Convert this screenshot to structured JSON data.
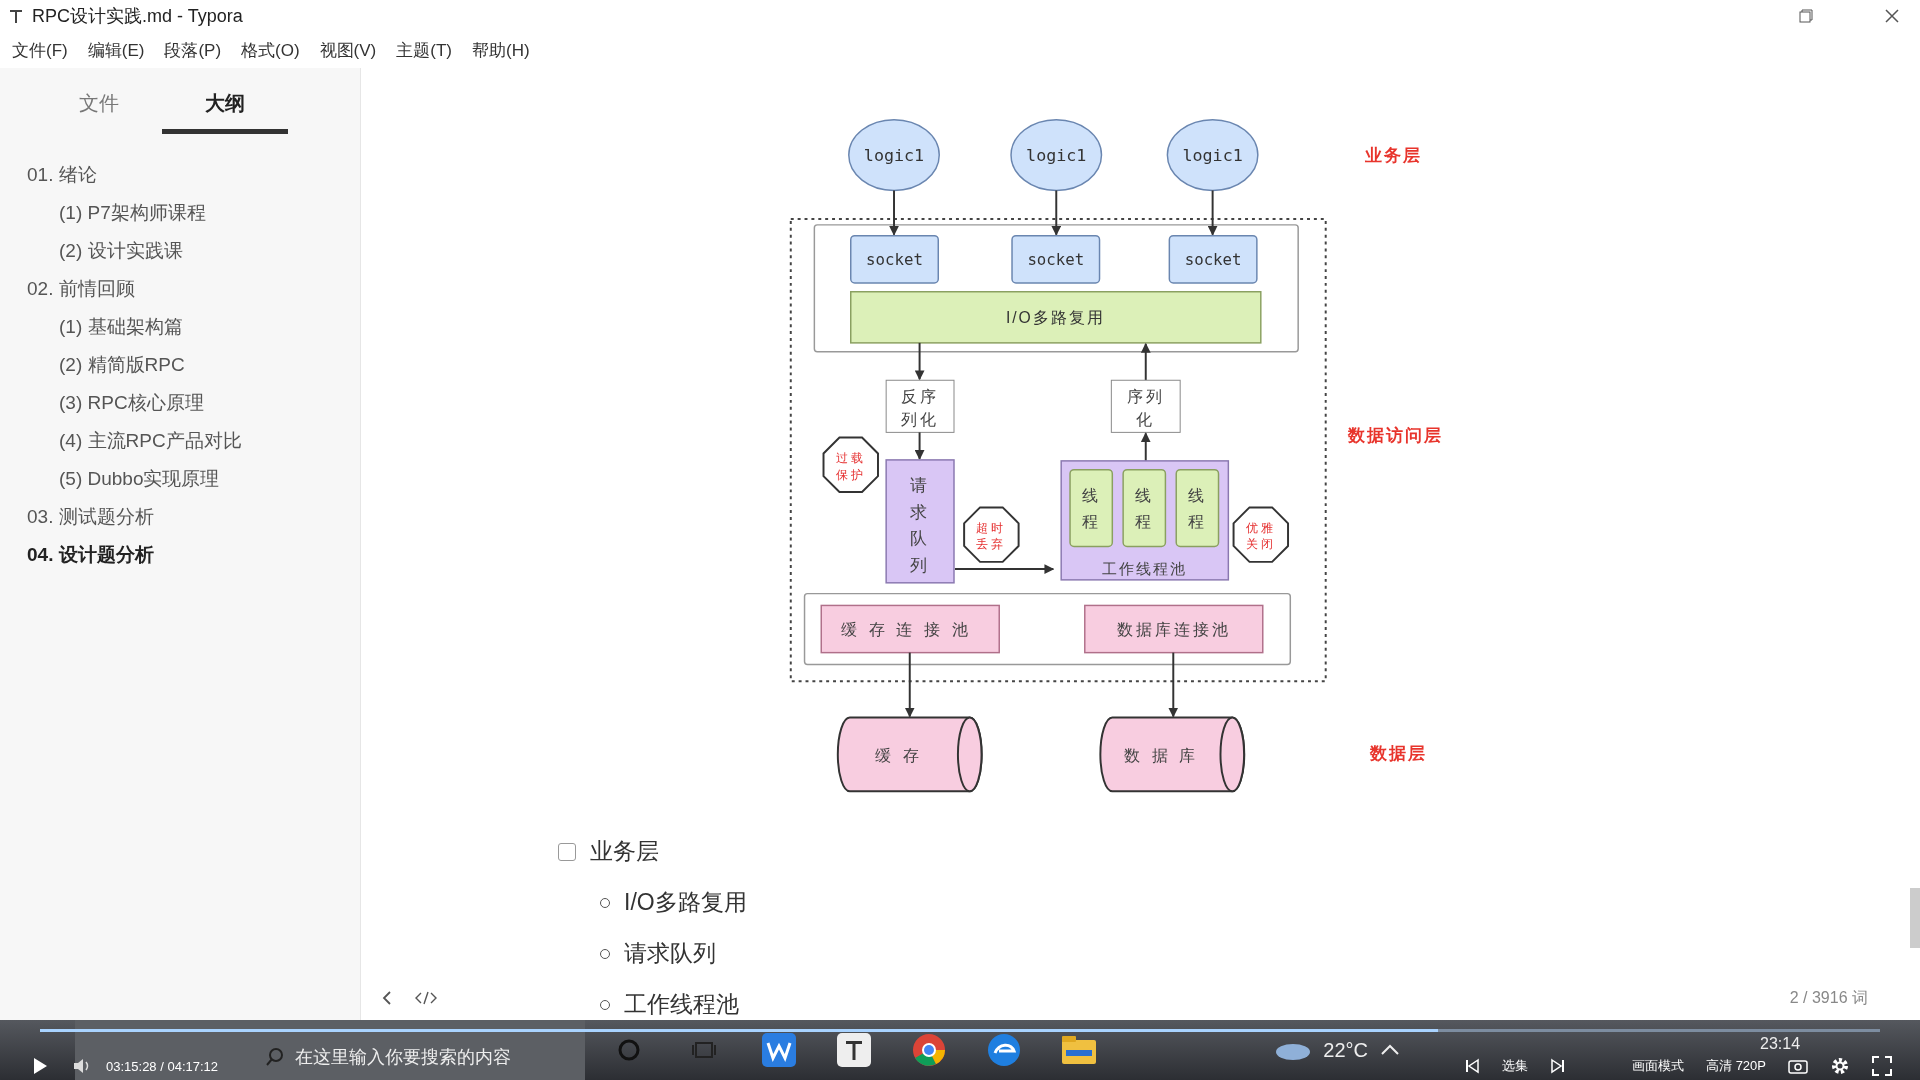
{
  "window": {
    "title": "RPC设计实践.md - Typora"
  },
  "menu": [
    "文件(F)",
    "编辑(E)",
    "段落(P)",
    "格式(O)",
    "视图(V)",
    "主题(T)",
    "帮助(H)"
  ],
  "sidebar": {
    "tabs": [
      {
        "label": "文件",
        "selected": false
      },
      {
        "label": "大纲",
        "selected": true
      }
    ],
    "outline": [
      {
        "label": "01. 绪论",
        "selected": false,
        "children": [
          {
            "label": "(1)  P7架构师课程",
            "selected": false
          },
          {
            "label": "(2)  设计实践课",
            "selected": false
          }
        ]
      },
      {
        "label": "02. 前情回顾",
        "selected": false,
        "children": [
          {
            "label": "(1)  基础架构篇",
            "selected": false
          },
          {
            "label": "(2)  精简版RPC",
            "selected": false
          },
          {
            "label": "(3)  RPC核心原理",
            "selected": false
          },
          {
            "label": "(4)  主流RPC产品对比",
            "selected": false
          },
          {
            "label": "(5)  Dubbo实现原理",
            "selected": false
          }
        ]
      },
      {
        "label": "03. 测试题分析",
        "selected": false
      },
      {
        "label": "04. 设计题分析",
        "selected": true
      }
    ]
  },
  "diagram": {
    "logic_nodes": [
      "logic1",
      "logic1",
      "logic1"
    ],
    "sockets": [
      "socket",
      "socket",
      "socket"
    ],
    "multiplexer": "I/O多路复用",
    "deserializer": "反序列化",
    "serializer": "序列化",
    "request_queue": "请求队列",
    "threads": [
      "线程",
      "线程",
      "线程"
    ],
    "thread_pool": "工作线程池",
    "guards": [
      "过载保护",
      "超时丢弃",
      "优雅关闭"
    ],
    "pools": [
      "缓存连接池",
      "数据库连接池"
    ],
    "stores": [
      "缓存",
      "数据库"
    ],
    "layers": [
      "业务层",
      "数据访问层",
      "数据层"
    ]
  },
  "content": {
    "task": {
      "label": "业务层",
      "checked": false
    },
    "bullets": [
      "I/O多路复用",
      "请求队列",
      "工作线程池"
    ]
  },
  "status_bar": {
    "word_count": "2 / 3916 词"
  },
  "taskbar": {
    "search_placeholder": "在这里输入你要搜索的内容",
    "weather": "22°C",
    "clock": "23:14"
  },
  "player": {
    "time": "03:15:28 / 04:17:12",
    "level": 0.76,
    "buttons": [
      "选集",
      "画面模式",
      "高清 720P"
    ]
  }
}
